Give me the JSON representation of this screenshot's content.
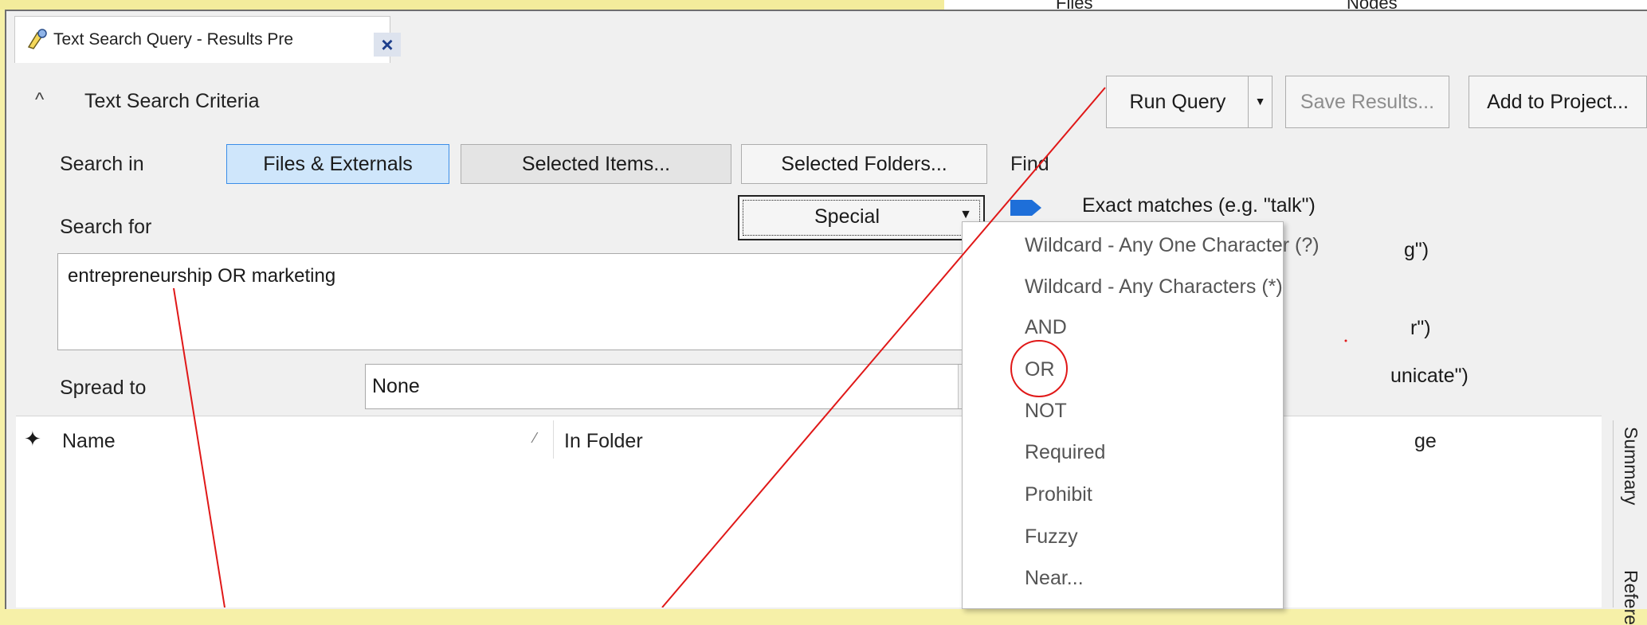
{
  "window": {
    "tab_title": "Text Search Query - Results Pre",
    "tab_close": "×"
  },
  "criteria": {
    "section_title": "Text Search Criteria",
    "run_query": "Run Query",
    "save_results": "Save Results...",
    "add_to_project": "Add to Project...",
    "search_in_label": "Search in",
    "search_in_options": [
      "Files & Externals",
      "Selected Items...",
      "Selected Folders..."
    ],
    "search_in_selected": "Files & Externals",
    "search_for_label": "Search for",
    "search_text": "entrepreneurship OR marketing",
    "special_value": "Special",
    "spread_to_label": "Spread to",
    "spread_to_value": "None",
    "find_label": "Find"
  },
  "find_options": [
    "Exact matches (e.g. \"talk\")",
    "g\")",
    "r\")",
    "unicate\")"
  ],
  "special_menu": [
    "Wildcard - Any One Character (?)",
    "Wildcard - Any Characters (*)",
    "AND",
    "OR",
    "NOT",
    "Required",
    "Prohibit",
    "Fuzzy",
    "Near..."
  ],
  "results_grid": {
    "columns": [
      "Name",
      "In Folder",
      "ge"
    ]
  },
  "side_tabs": [
    "Summary",
    "Refere"
  ],
  "top_strip": [
    "Files",
    "Nodes"
  ],
  "colors": {
    "accent_selected": "#cfe6fb",
    "annotation": "#e01818",
    "tag_blue": "#1e6fd9",
    "background_outer": "#f6f0a8"
  }
}
